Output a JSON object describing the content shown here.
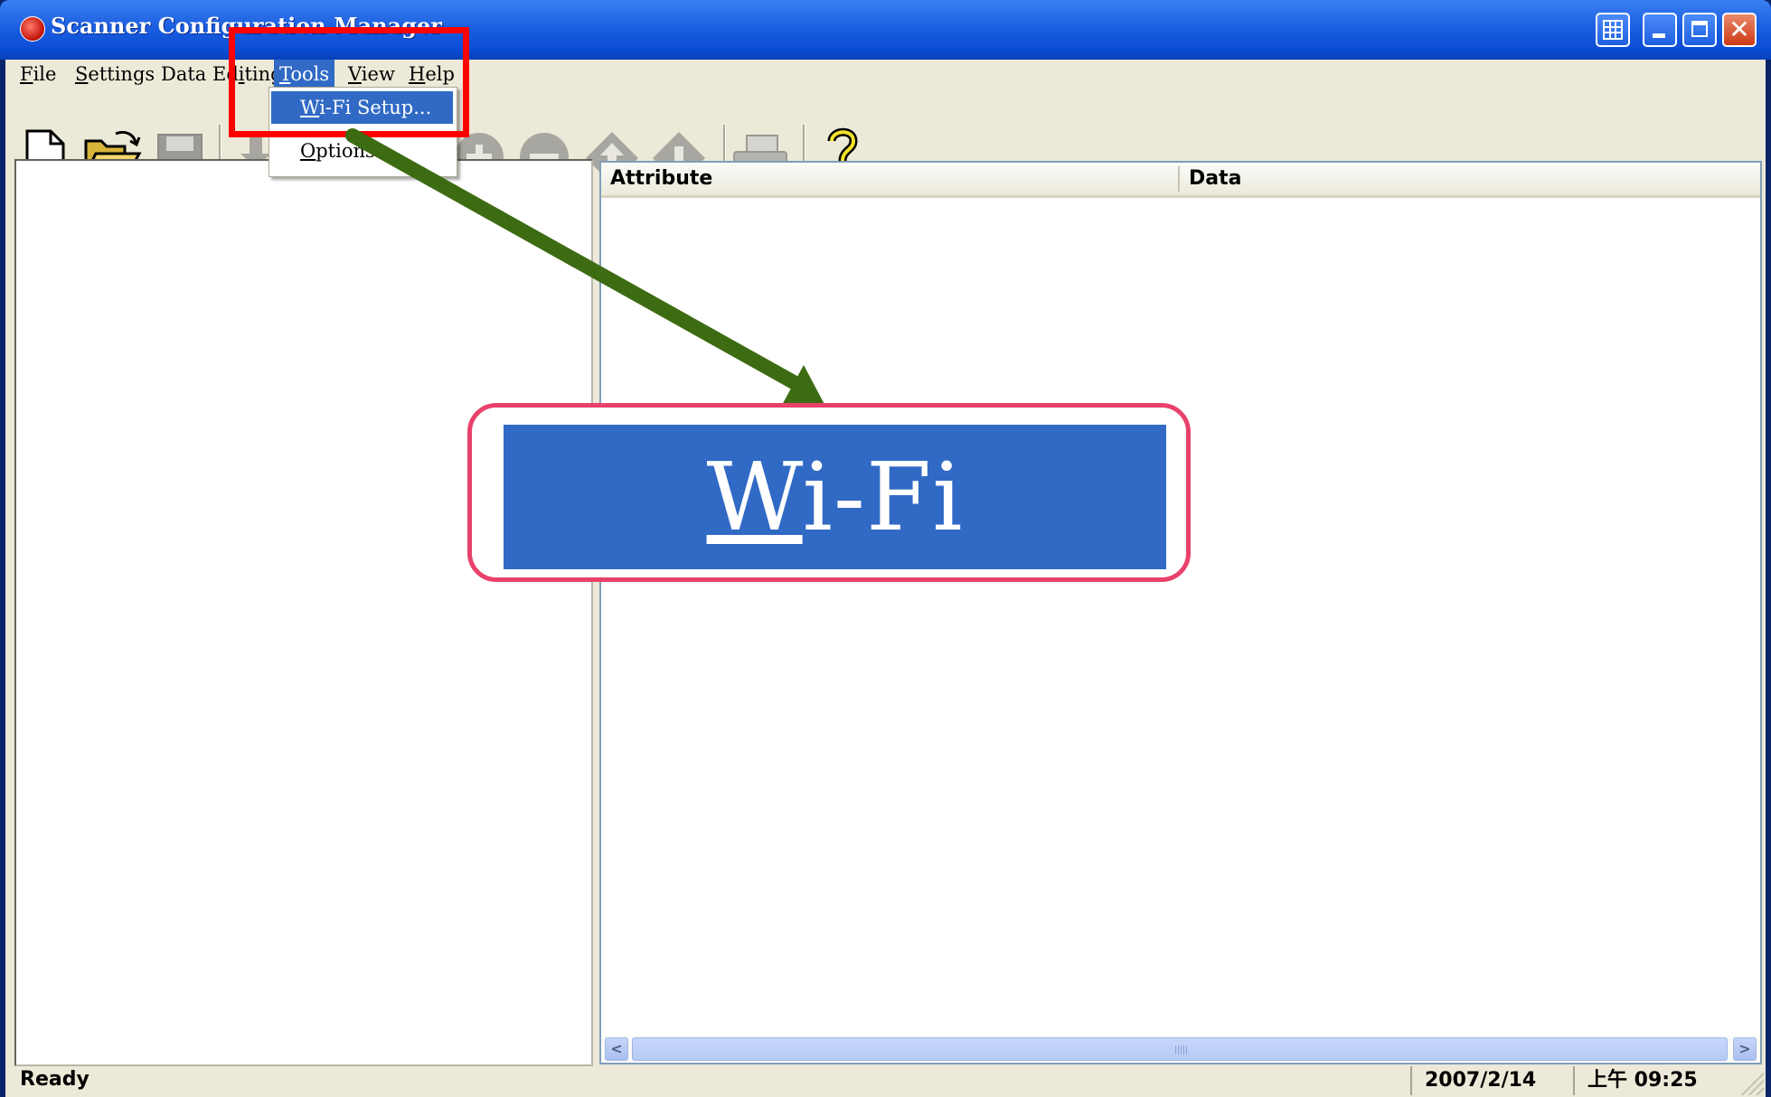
{
  "window": {
    "title": "Scanner Configuration Manager"
  },
  "menubar": {
    "items": [
      "File",
      "Settings",
      "Data Editing",
      "Tools",
      "View",
      "Help"
    ]
  },
  "tools_menu": {
    "items": [
      {
        "underline": "W",
        "rest": "i-Fi Setup..."
      },
      {
        "underline": "O",
        "rest": "ptions..."
      }
    ]
  },
  "list": {
    "columns": [
      "Attribute",
      "Data"
    ]
  },
  "statusbar": {
    "text": "Ready",
    "date": "2007/2/14",
    "time": "上午 09:25"
  },
  "callout": {
    "underline": "W",
    "rest": "i-Fi Setup..."
  },
  "colors": {
    "highlight": "#316ac5",
    "annotation_box": "#ff0000",
    "arrow": "#3d6b12",
    "callout_frame": "#e8426b"
  },
  "toolbar": {
    "icons": [
      "new-document-icon",
      "open-folder-icon",
      "save-disk-icon",
      "download-icon",
      "add-circle-icon",
      "remove-circle-icon",
      "move-up-icon",
      "move-down-icon",
      "print-icon",
      "help-question-icon"
    ]
  }
}
